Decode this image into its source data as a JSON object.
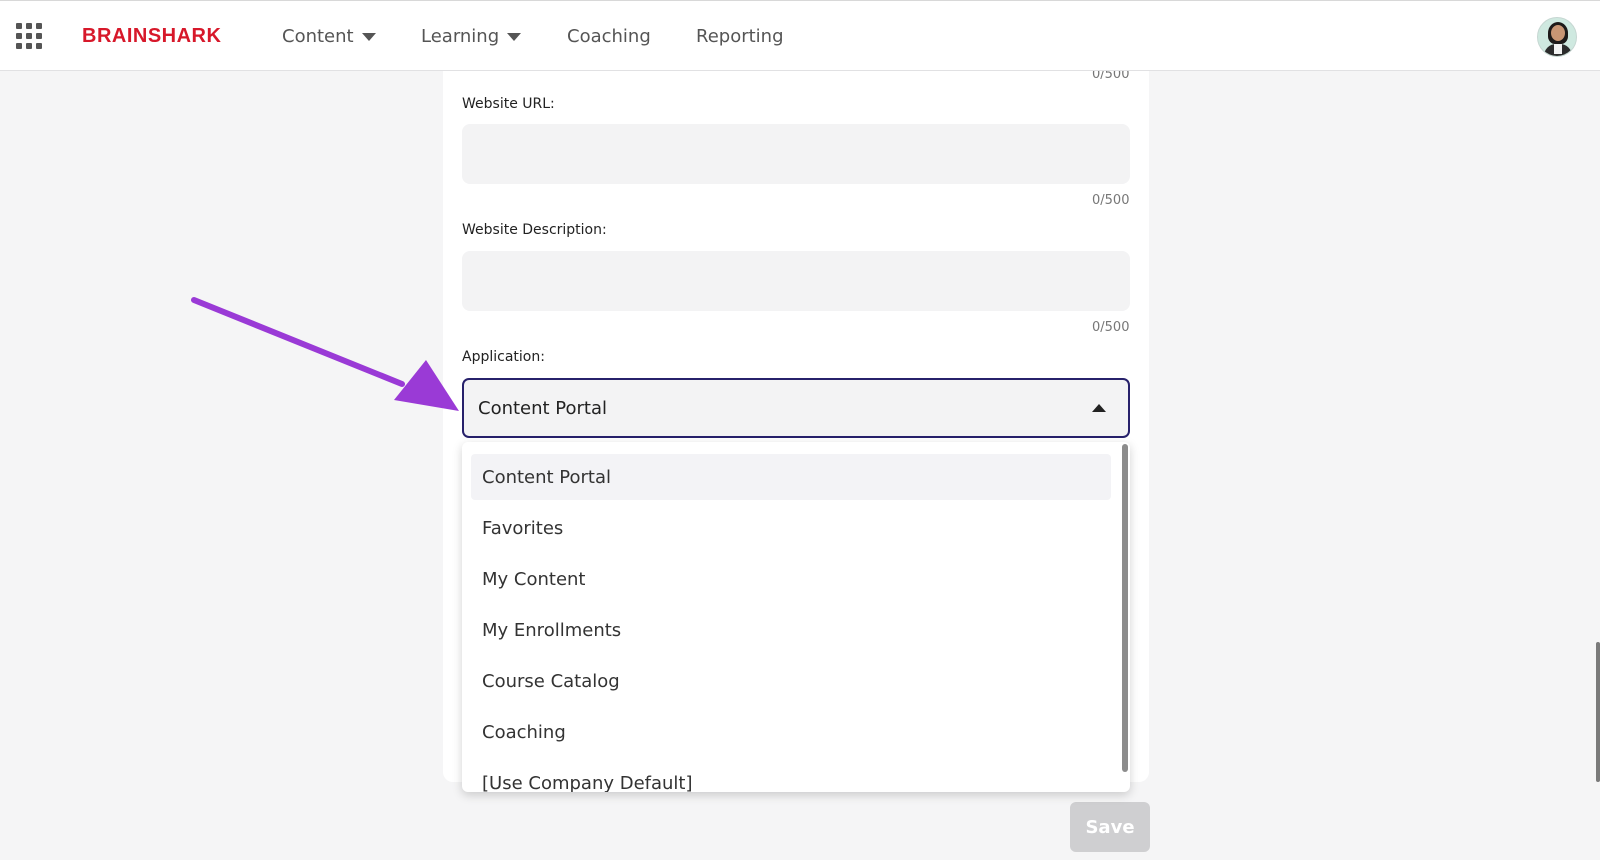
{
  "header": {
    "logo": "BRAINSHARK",
    "nav": [
      {
        "label": "Content",
        "has_dropdown": true
      },
      {
        "label": "Learning",
        "has_dropdown": true
      },
      {
        "label": "Coaching",
        "has_dropdown": false
      },
      {
        "label": "Reporting",
        "has_dropdown": false
      }
    ],
    "icons": {
      "apps": "apps-grid-icon",
      "avatar": "user-avatar"
    }
  },
  "form": {
    "top_counter": "0/500",
    "website_url": {
      "label": "Website URL:",
      "value": "",
      "counter": "0/500"
    },
    "website_description": {
      "label": "Website Description:",
      "value": "",
      "counter": "0/500"
    },
    "application": {
      "label": "Application:",
      "selected": "Content Portal",
      "expanded": true,
      "options": [
        "Content Portal",
        "Favorites",
        "My Content",
        "My Enrollments",
        "Course Catalog",
        "Coaching",
        "[Use Company Default]"
      ]
    },
    "save_label": "Save"
  },
  "colors": {
    "brand": "#d7182a",
    "select_border": "#27216b",
    "annotation_arrow": "#9a3ad6",
    "save_disabled": "#cfcfd1"
  }
}
